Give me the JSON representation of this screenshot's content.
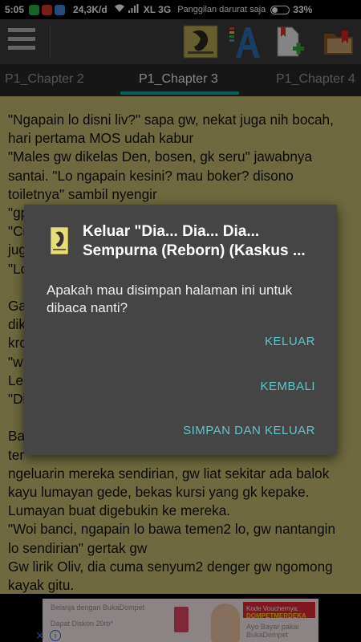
{
  "status_bar": {
    "time": "5:05",
    "net_speed": "24,3K/d",
    "carrier": "XL 3G",
    "emergency": "Panggilan darurat saja",
    "battery": "33%"
  },
  "toolbar": {
    "menu_icon": "hamburger-menu-icon",
    "book_cover_icon": "book-cover-icon",
    "font_icon": "font-style-icon",
    "add_file_icon": "add-document-icon",
    "bookmark_icon": "bookmark-folder-icon"
  },
  "tabs": [
    {
      "label": "P1_Chapter 2"
    },
    {
      "label": "P1_Chapter 3"
    },
    {
      "label": "P1_Chapter 4"
    }
  ],
  "reader": {
    "text": "\"Ngapain lo disni liv?\" sapa gw, nekat juga nih bocah,\nhari pertama MOS udah kabur\n\"Males gw dikelas Den, bosen, gk seru\" jawabnya\nsantai. \"Lo ngapain kesini? mau boker? disono\ntoiletnya\" sambil nyengir\n\"gp\n\"Ci\njug\n\"Lo\n\nGa\ndik\nkro\n\"w\nLe\n\"Di\n\nBa\nter\nngeluarin mereka sendirian, gw liat sekitar ada balok\nkayu lumayan gede, bekas kursi yang gk kepake.\nLumayan buat digebukin ke mereka.\n\"Woi banci, ngapain lo bawa temen2 lo, gw nantangin\nlo sendirian\" gertak gw\nGw lirik Oliv, dia cuma senyum2 denger gw ngomong\nkayak gitu.\n\"Lo yang banci, ngapain lo ngajakin oliv kesini?\"\njawab dia."
  },
  "dialog": {
    "title": "Keluar \"Dia... Dia... Dia... Sempurna (Reborn) (Kaskus ...",
    "message": "Apakah mau disimpan halaman ini untuk dibaca nanti?",
    "buttons": {
      "exit": "KELUAR",
      "back": "KEMBALI",
      "save_exit": "SIMPAN DAN KELUAR"
    }
  },
  "ad": {
    "text_left": "Belanja dengan BukaDompet",
    "text_left2": "Dapat Diskon 20rb*",
    "promo_label": "Kode Vouchernya:",
    "promo_code": "DOMPETMERDEKA",
    "text_right": "Ayo Bayar pakai BukaDompet"
  }
}
